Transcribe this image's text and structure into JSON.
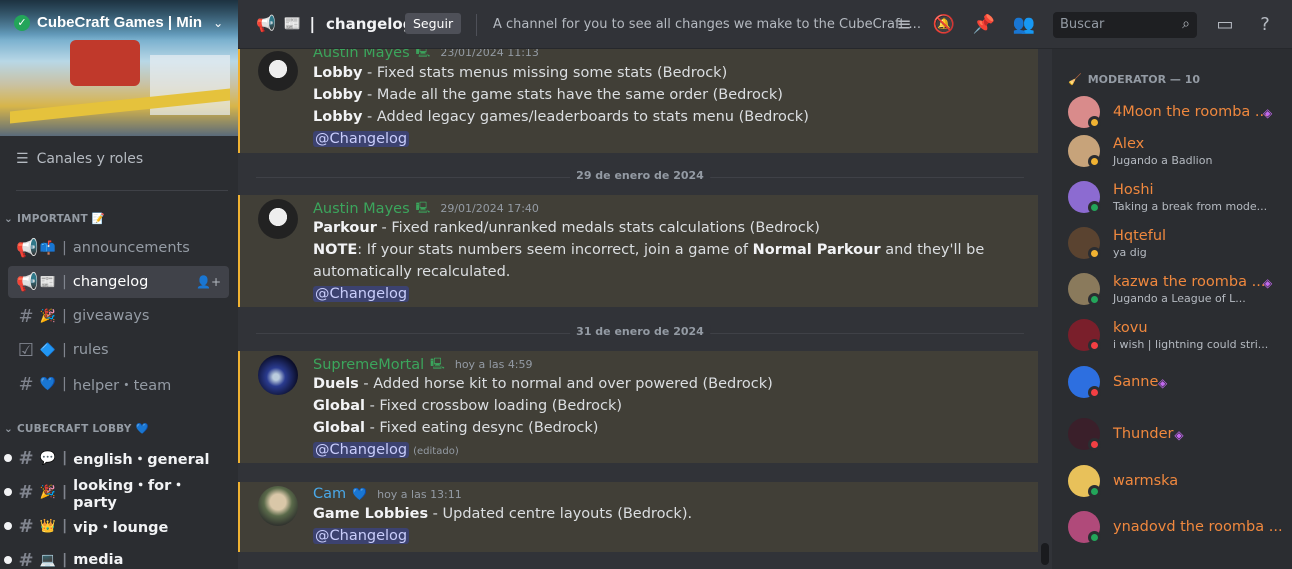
{
  "server": {
    "name": "CubeCraft Games | Min",
    "roles_label": "Canales y roles"
  },
  "categories": [
    {
      "label": "IMPORTANT",
      "emoji": "📝"
    },
    {
      "label": "CUBECRAFT LOBBY",
      "emoji": "💙"
    }
  ],
  "channels": [
    {
      "icon": "megaphone-icon",
      "emoji": "📫",
      "name": "announcements"
    },
    {
      "icon": "megaphone-icon",
      "emoji": "📰",
      "name": "changelog"
    },
    {
      "icon": "hash-icon",
      "emoji": "🎉",
      "name": "giveaways"
    },
    {
      "icon": "rules-icon",
      "emoji": "🔷",
      "name": "rules"
    },
    {
      "icon": "hash-icon",
      "emoji": "💙",
      "name": "helper・team"
    },
    {
      "icon": "hash-icon",
      "emoji": "💬",
      "name": "english・general"
    },
    {
      "icon": "hash-icon",
      "emoji": "🎉",
      "name": "looking・for・party"
    },
    {
      "icon": "hash-icon",
      "emoji": "👑",
      "name": "vip・lounge"
    },
    {
      "icon": "hash-icon",
      "emoji": "💻",
      "name": "media"
    }
  ],
  "header": {
    "channel": "changelog",
    "follow": "Seguir",
    "topic": "A channel for you to see all changes we make to the CubeCraft ...",
    "search_placeholder": "Buscar"
  },
  "messages": [
    {
      "author": "Austin Mayes",
      "color": "#3ba55c",
      "timestamp": "23/01/2024 11:13",
      "lines": [
        {
          "bold": "Lobby",
          "text": " - Fixed stats menus missing some stats (Bedrock)"
        },
        {
          "bold": "Lobby",
          "text": " - Made all the game stats have the same order (Bedrock)"
        },
        {
          "bold": "Lobby",
          "text": " - Added legacy games/leaderboards to stats menu (Bedrock)"
        }
      ],
      "mention": "@Changelog"
    },
    {
      "author": "Austin Mayes",
      "color": "#3ba55c",
      "timestamp": "29/01/2024 17:40",
      "lines": [
        {
          "bold": "Parkour",
          "text": " - Fixed ranked/unranked medals stats calculations (Bedrock)"
        },
        {
          "bold": "NOTE",
          "text": ": If your stats numbers seem incorrect, join a game of ",
          "bold2": "Normal Parkour",
          "text2": " and they'll be"
        },
        {
          "text": "automatically recalculated."
        }
      ],
      "mention": "@Changelog"
    },
    {
      "author": "SupremeMortal",
      "color": "#3ba55c",
      "timestamp": "hoy a las 4:59",
      "lines": [
        {
          "bold": "Duels",
          "text": " - Added horse kit to normal and over powered (Bedrock)"
        },
        {
          "bold": "Global",
          "text": " - Fixed crossbow loading (Bedrock)"
        },
        {
          "bold": "Global",
          "text": " - Fixed eating desync (Bedrock)"
        }
      ],
      "mention": "@Changelog",
      "edited": "(editado)"
    },
    {
      "author": "Cam",
      "color": "#4aa8e8",
      "timestamp": "hoy a las 13:11",
      "lines": [
        {
          "bold": "Game Lobbies",
          "text": " - Updated centre layouts (Bedrock)."
        }
      ],
      "mention": "@Changelog"
    }
  ],
  "dates": [
    "29 de enero de 2024",
    "31 de enero de 2024"
  ],
  "members_category": "MODERATOR — 10",
  "members": [
    {
      "name": "4Moon the roomba ...",
      "sub": "",
      "status": "idle",
      "gem": true,
      "avatar_color": "#d98b8b"
    },
    {
      "name": "Alex",
      "sub": "Jugando a Badlion",
      "status": "idle",
      "gem": false,
      "avatar_color": "#c7a37a"
    },
    {
      "name": "Hoshi",
      "sub": "Taking a break from mode...",
      "status": "mobile",
      "gem": false,
      "avatar_color": "#8c6bd1"
    },
    {
      "name": "Hqteful",
      "sub": "ya dig",
      "status": "idle",
      "gem": false,
      "avatar_color": "#5a4330"
    },
    {
      "name": "kazwa the roomba ...",
      "sub": "Jugando a League of L...",
      "status": "online",
      "gem": true,
      "avatar_color": "#8a7a5c"
    },
    {
      "name": "kovu",
      "sub": "i wish | lightning could stri...",
      "status": "dnd",
      "gem": false,
      "avatar_color": "#7a1f2b"
    },
    {
      "name": "Sanne",
      "sub": "",
      "status": "dnd",
      "gem": true,
      "avatar_color": "#2d6fe0"
    },
    {
      "name": "Thunder",
      "sub": "",
      "status": "dnd",
      "gem": true,
      "avatar_color": "#3a1f2a"
    },
    {
      "name": "warmska",
      "sub": "",
      "status": "online",
      "gem": false,
      "avatar_color": "#e8c15a"
    },
    {
      "name": "ynadovd the roomba ...",
      "sub": "",
      "status": "online",
      "gem": false,
      "avatar_color": "#b04a7a"
    }
  ]
}
